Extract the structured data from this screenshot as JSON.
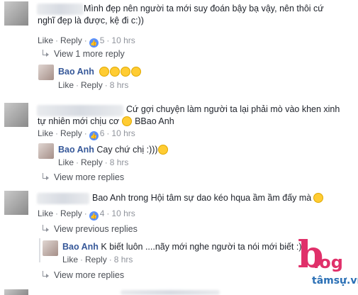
{
  "comments": [
    {
      "text_line1": "Mình đẹp nên người ta mới suy đoán bậy bạ vậy, nên thôi cứ",
      "text_line2": "nghĩ đẹp là được, kệ đi c:))",
      "like": "Like",
      "reply": "Reply",
      "likes": "5",
      "time": "10 hrs",
      "more_replies": "View 1 more reply",
      "replies": [
        {
          "name": "Bao Anh",
          "text": "",
          "emoji_count": 4,
          "like": "Like",
          "reply": "Reply",
          "time": "8 hrs"
        }
      ]
    },
    {
      "text_line1": "Cứ gợi chuyện làm người ta lại phải mò vào khen xinh",
      "text_line2": "tự nhiên mới chịu cơ",
      "text_line2_tail": "BBao Anh",
      "like": "Like",
      "reply": "Reply",
      "likes": "6",
      "time": "10 hrs",
      "replies": [
        {
          "name": "Bao Anh",
          "text": "Cay chứ chị :)))",
          "like": "Like",
          "reply": "Reply",
          "time": "8 hrs"
        }
      ],
      "more_replies": "View more replies"
    },
    {
      "text_line1": "Bao Anh trong Hội tâm sự dao kéo hqua ầm ầm đấy mà",
      "like": "Like",
      "reply": "Reply",
      "likes": "4",
      "time": "10 hrs",
      "previous_replies": "View previous replies",
      "replies": [
        {
          "name": "Bao Anh",
          "text": "K biết luôn ....nãy mới nghe người ta nói mới biết :)",
          "like": "Like",
          "reply": "Reply",
          "time": "8 hrs"
        }
      ],
      "more_replies": "View more replies"
    }
  ],
  "watermark": {
    "letter": "b",
    "word": "log",
    "site": "tâmsự.vn"
  },
  "colors": {
    "link": "#365899",
    "meta": "#90949c",
    "like_icon": "#5890ff",
    "watermark_pink": "#e0306a",
    "watermark_blue": "#2a6fb5"
  },
  "icons": {
    "like": "thumbs-up-icon",
    "reply_arrow": "reply-arrow-icon",
    "emoji": "emoji-icon"
  }
}
